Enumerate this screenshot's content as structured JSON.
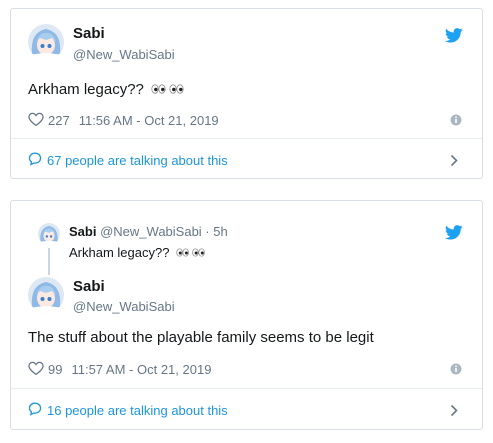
{
  "tweet1": {
    "name": "Sabi",
    "handle": "@New_WabiSabi",
    "text": "Arkham legacy?? ",
    "likes": "227",
    "timestamp": "11:56 AM - Oct 21, 2019",
    "talking": "67 people are talking about this"
  },
  "tweet2": {
    "quoted": {
      "name": "Sabi",
      "handle": "@New_WabiSabi · 5h",
      "text": "Arkham legacy?? "
    },
    "name": "Sabi",
    "handle": "@New_WabiSabi",
    "text": "The stuff about the playable family seems to be legit",
    "likes": "99",
    "timestamp": "11:57 AM - Oct 21, 2019",
    "talking": "16 people are talking about this"
  },
  "colors": {
    "twitter_blue": "#1da1f2",
    "link_blue": "#1b95e0",
    "muted_gray": "#657786",
    "border": "#d8dee3"
  },
  "icons": [
    "twitter-bird-icon",
    "heart-icon",
    "info-icon",
    "speech-bubble-icon",
    "chevron-right-icon",
    "eyes-emoji"
  ]
}
